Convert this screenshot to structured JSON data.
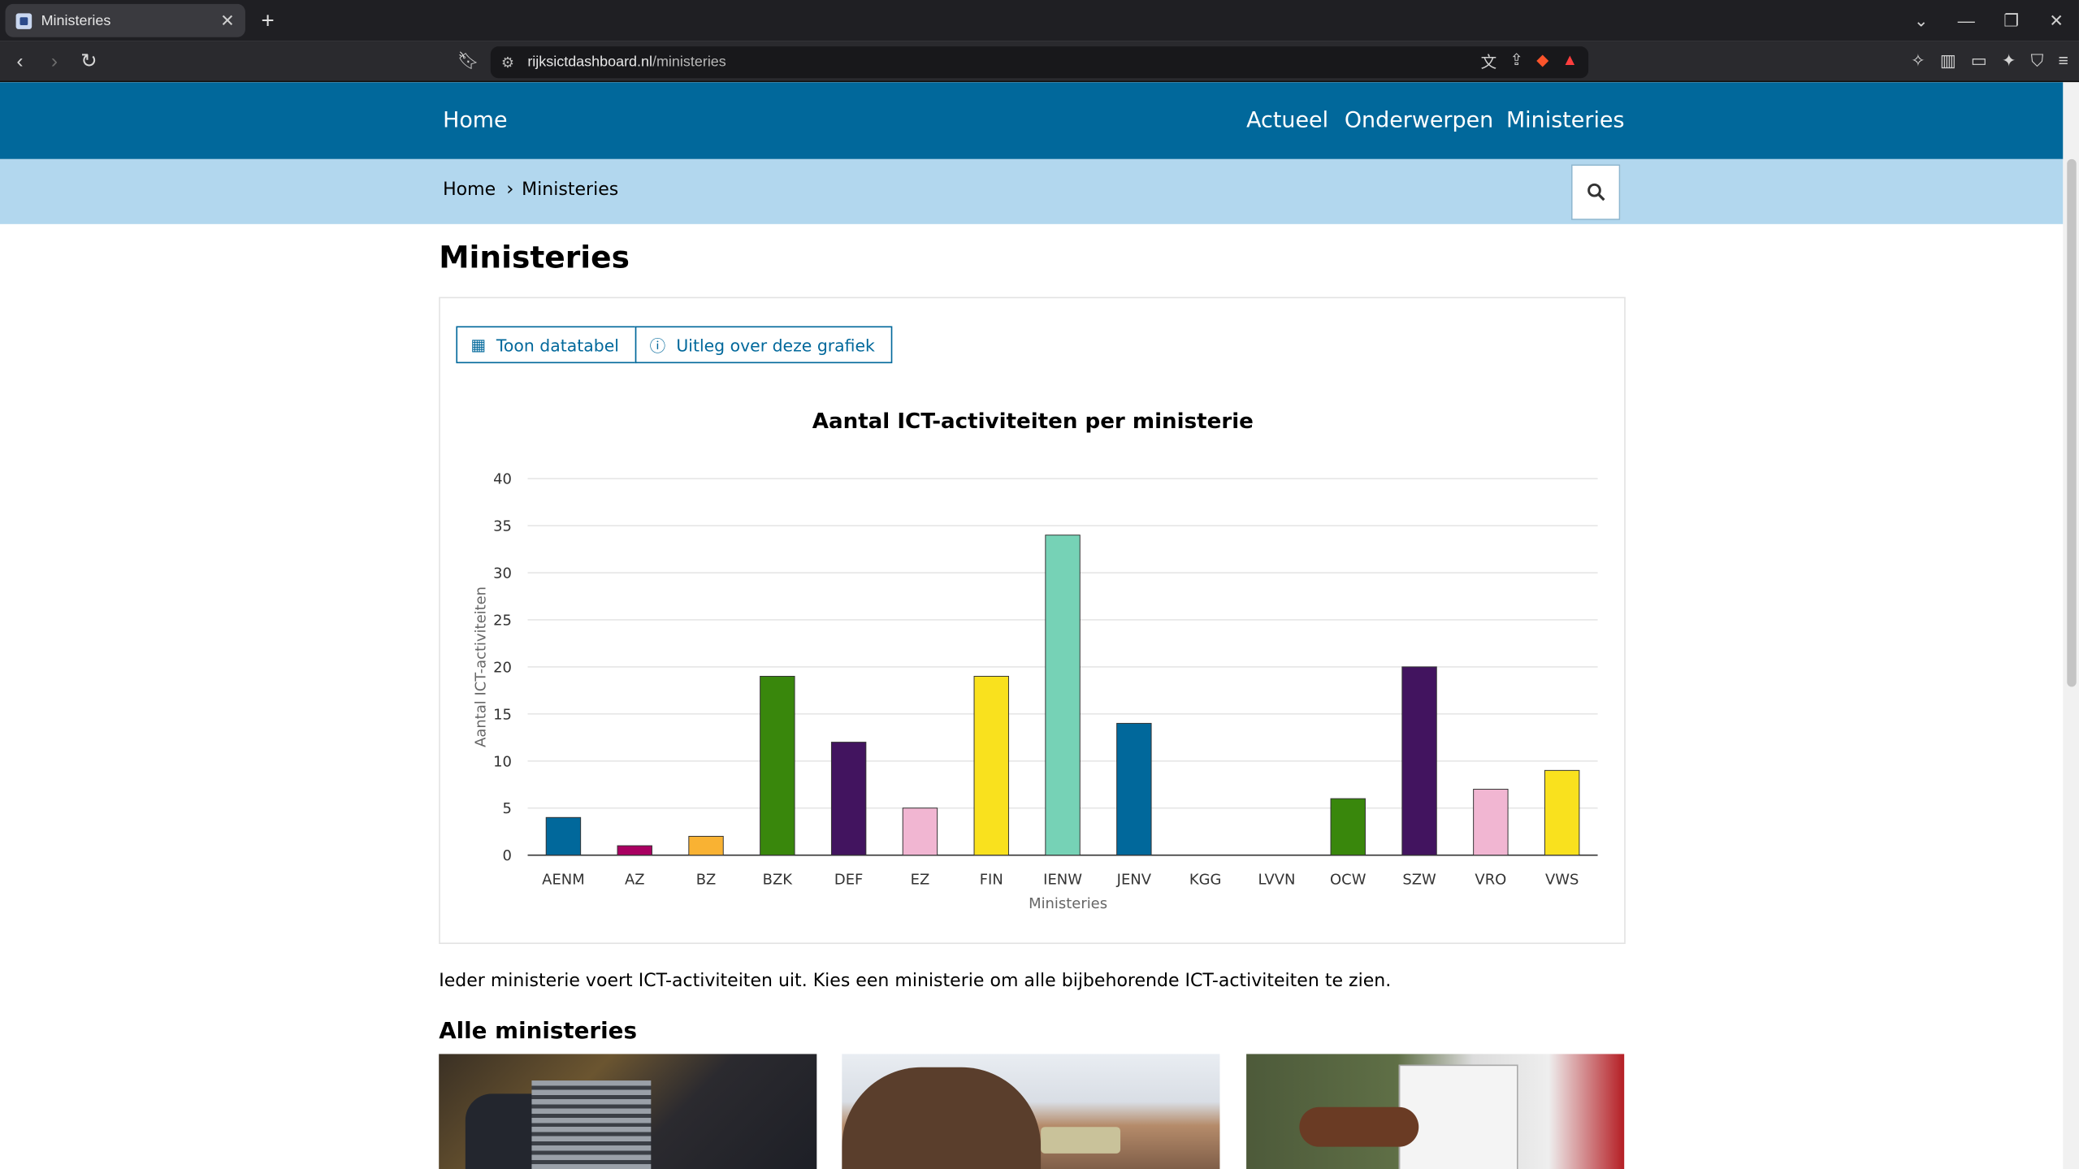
{
  "browser": {
    "tab_title": "Ministeries",
    "new_tab_icon": "plus-icon",
    "url_domain": "rijksictdashboard.nl",
    "url_path": "/ministeries"
  },
  "site": {
    "home_label": "Home",
    "nav": [
      "Actueel",
      "Onderwerpen",
      "Ministeries"
    ],
    "breadcrumb": [
      "Home",
      "Ministeries"
    ],
    "header_color": "#01689b",
    "breadcrumb_bg": "#b2d7ee"
  },
  "page": {
    "title": "Ministeries",
    "btn_table": "Toon datatabel",
    "btn_info": "Uitleg over deze grafiek",
    "intro": "Ieder ministerie voert ICT-activiteiten uit. Kies een ministerie om alle bijbehorende ICT-activiteiten te zien.",
    "section_title": "Alle ministeries"
  },
  "chart_data": {
    "type": "bar",
    "title": "Aantal ICT-activiteiten per ministerie",
    "xlabel": "Ministeries",
    "ylabel": "Aantal ICT-activiteiten",
    "ylim": [
      0,
      40
    ],
    "yticks": [
      0,
      5,
      10,
      15,
      20,
      25,
      30,
      35,
      40
    ],
    "grid": true,
    "categories": [
      "AENM",
      "AZ",
      "BZ",
      "BZK",
      "DEF",
      "EZ",
      "FIN",
      "IENW",
      "JENV",
      "KGG",
      "LVVN",
      "OCW",
      "SZW",
      "VRO",
      "VWS"
    ],
    "values": [
      4,
      1,
      2,
      19,
      12,
      5,
      19,
      34,
      14,
      0,
      0,
      6,
      20,
      7,
      9
    ],
    "colors": [
      "#01689b",
      "#a90061",
      "#f9b233",
      "#39870c",
      "#42145f",
      "#f1b6d2",
      "#f9e11e",
      "#76d2b6",
      "#01689b",
      "#cccccc",
      "#cccccc",
      "#39870c",
      "#42145f",
      "#f1b6d2",
      "#f9e11e"
    ]
  }
}
